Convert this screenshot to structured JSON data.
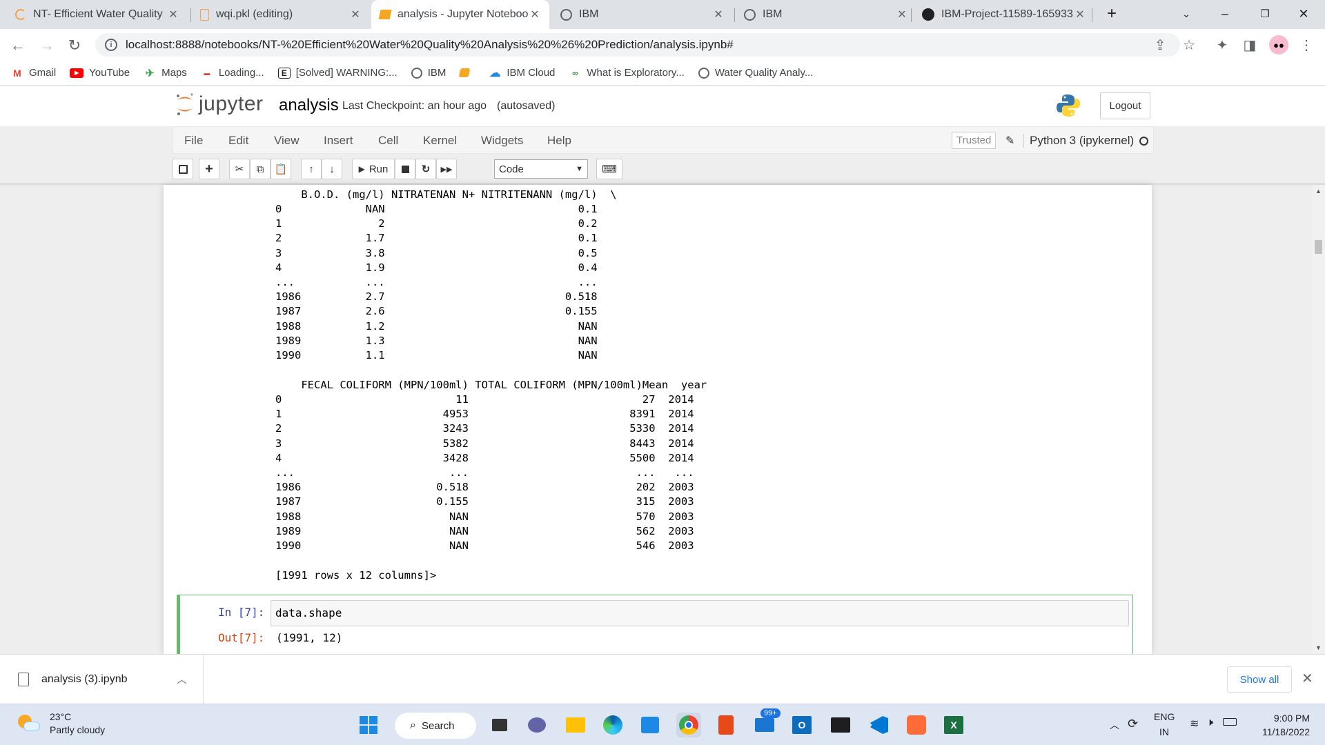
{
  "browser": {
    "tabs": [
      {
        "title": "NT- Efficient Water Quality",
        "icon": "loading-ring-icon"
      },
      {
        "title": "wqi.pkl (editing)",
        "icon": "file-icon"
      },
      {
        "title": "analysis - Jupyter Notebook",
        "icon": "jupyter-book-icon"
      },
      {
        "title": "IBM",
        "icon": "globe-icon"
      },
      {
        "title": "IBM",
        "icon": "globe-icon"
      },
      {
        "title": "IBM-Project-11589-165933",
        "icon": "github-icon"
      }
    ],
    "url": "localhost:8888/notebooks/NT-%20Efficient%20Water%20Quality%20Analysis%20%26%20Prediction/analysis.ipynb#",
    "bookmarks": [
      {
        "label": "Gmail",
        "icon": "gmail-icon"
      },
      {
        "label": "YouTube",
        "icon": "youtube-icon"
      },
      {
        "label": "Maps",
        "icon": "maps-icon"
      },
      {
        "label": "Loading...",
        "icon": "site-icon"
      },
      {
        "label": "[Solved] WARNING:...",
        "icon": "e-icon"
      },
      {
        "label": "IBM",
        "icon": "globe-icon"
      },
      {
        "label": "",
        "icon": "jupyter-book-icon"
      },
      {
        "label": "IBM Cloud",
        "icon": "cloud-icon"
      },
      {
        "label": "What is Exploratory...",
        "icon": "site-icon"
      },
      {
        "label": "Water Quality Analy...",
        "icon": "globe-icon"
      }
    ]
  },
  "jupyter": {
    "logo_text": "jupyter",
    "notebook_name": "analysis",
    "checkpoint": "Last Checkpoint: an hour ago",
    "autosave": "(autosaved)",
    "logout": "Logout",
    "menu": [
      "File",
      "Edit",
      "View",
      "Insert",
      "Cell",
      "Kernel",
      "Widgets",
      "Help"
    ],
    "trusted": "Trusted",
    "kernel": "Python 3 (ipykernel)",
    "run_label": "Run",
    "cell_type": "Code"
  },
  "output": {
    "block1_header": "    B.O.D. (mg/l) NITRATENAN N+ NITRITENANN (mg/l)  \\",
    "block1_rows": [
      "0             NAN                              0.1",
      "1               2                              0.2",
      "2             1.7                              0.1",
      "3             3.8                              0.5",
      "4             1.9                              0.4",
      "...           ...                              ...",
      "1986          2.7                            0.518",
      "1987          2.6                            0.155",
      "1988          1.2                              NAN",
      "1989          1.3                              NAN",
      "1990          1.1                              NAN"
    ],
    "block2_header": "    FECAL COLIFORM (MPN/100ml) TOTAL COLIFORM (MPN/100ml)Mean  year",
    "block2_rows": [
      "0                           11                           27  2014",
      "1                         4953                         8391  2014",
      "2                         3243                         5330  2014",
      "3                         5382                         8443  2014",
      "4                         3428                         5500  2014",
      "...                        ...                          ...   ...",
      "1986                     0.518                          202  2003",
      "1987                     0.155                          315  2003",
      "1988                       NAN                          570  2003",
      "1989                       NAN                          562  2003",
      "1990                       NAN                          546  2003"
    ],
    "summary": "[1991 rows x 12 columns]>"
  },
  "cell7": {
    "in_prompt": "In [7]:",
    "code": "data.shape",
    "out_prompt": "Out[7]:",
    "result": "(1991, 12)"
  },
  "downloads": {
    "file": "analysis (3).ipynb",
    "show_all": "Show all"
  },
  "taskbar": {
    "temp": "23°C",
    "weather": "Partly cloudy",
    "search": "Search",
    "badge": "99+",
    "lang1": "ENG",
    "lang2": "IN",
    "time": "9:00 PM",
    "date": "11/18/2022"
  }
}
